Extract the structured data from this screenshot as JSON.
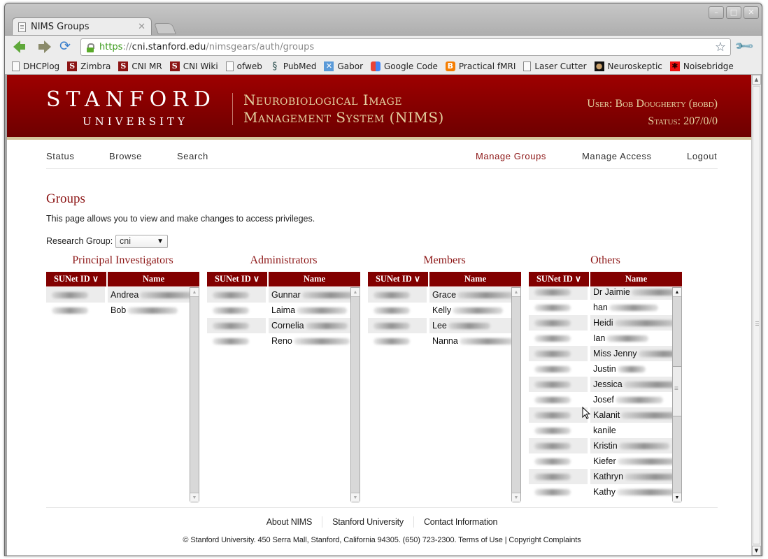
{
  "browser": {
    "tab_title": "NIMS Groups",
    "url": {
      "scheme": "https",
      "separator": "://",
      "host": "cni.stanford.edu",
      "path": "/nimsgears/auth/groups"
    },
    "window_controls": {
      "minimize": "–",
      "maximize": "□",
      "close": "✕"
    },
    "bookmarks": [
      {
        "label": "DHCPlog",
        "icon": "page"
      },
      {
        "label": "Zimbra",
        "icon": "stanford"
      },
      {
        "label": "CNI MR",
        "icon": "stanford"
      },
      {
        "label": "CNI Wiki",
        "icon": "stanford"
      },
      {
        "label": "ofweb",
        "icon": "page"
      },
      {
        "label": "PubMed",
        "icon": "pubmed"
      },
      {
        "label": "Gabor",
        "icon": "gabor"
      },
      {
        "label": "Google Code",
        "icon": "gcode"
      },
      {
        "label": "Practical fMRI",
        "icon": "blogger"
      },
      {
        "label": "Laser Cutter",
        "icon": "page"
      },
      {
        "label": "Neuroskeptic",
        "icon": "neuro"
      },
      {
        "label": "Noisebridge",
        "icon": "noise"
      }
    ]
  },
  "header": {
    "logo_main": "STANFORD",
    "logo_sub": "UNIVERSITY",
    "app_title_line1": "Neurobiological Image",
    "app_title_line2": "Management System (NIMS)",
    "user": "User: Bob Dougherty (bobd)",
    "status": "Status: 207/0/0"
  },
  "nav": {
    "left": [
      "Status",
      "Browse",
      "Search"
    ],
    "right": [
      "Manage Groups",
      "Manage Access",
      "Logout"
    ],
    "active": "Manage Groups"
  },
  "page": {
    "title": "Groups",
    "intro": "This page allows you to view and make changes to access privileges.",
    "research_group_label": "Research Group:",
    "research_group_value": "cni"
  },
  "columns": {
    "id": "SUNet ID ∨",
    "name": "Name"
  },
  "panels": {
    "pis": {
      "title": "Principal Investigators",
      "rows": [
        "Andrea",
        "Bob"
      ]
    },
    "admins": {
      "title": "Administrators",
      "rows": [
        "Gunnar",
        "Laima",
        "Cornelia",
        "Reno"
      ]
    },
    "members": {
      "title": "Members",
      "rows": [
        "Grace",
        "Kelly",
        "Lee",
        "Nanna"
      ]
    },
    "others": {
      "title": "Others",
      "rows": [
        "Dr Jaimie",
        "han",
        "Heidi",
        "Ian",
        "Miss Jenny",
        "Justin",
        "Jessica",
        "Josef",
        "Kalanit",
        "kanile",
        "Kristin",
        "Kiefer",
        "Kathryn",
        "Kathy"
      ]
    }
  },
  "footer": {
    "links": [
      "About NIMS",
      "Stanford University",
      "Contact Information"
    ],
    "copyright": "© Stanford University. 450 Serra Mall, Stanford, California 94305. (650) 723-2300. Terms of Use | Copyright Complaints"
  }
}
